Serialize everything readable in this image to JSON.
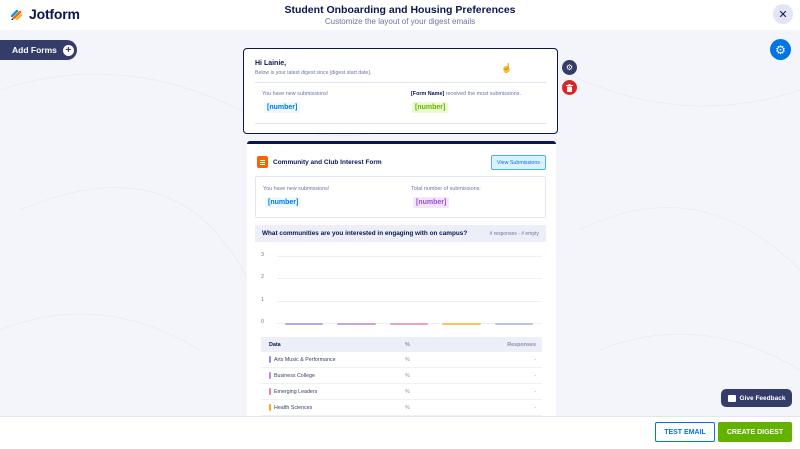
{
  "header": {
    "logo_text": "Jotform",
    "title": "Student Onboarding and Housing Preferences",
    "subtitle": "Customize the layout of your digest emails",
    "close_icon": "close-icon"
  },
  "sidebar": {
    "add_forms_label": "Add Forms"
  },
  "greeting": {
    "hi": "Hi Lainie,",
    "intro": "Below is your latest digest since [digest start date].",
    "new_submissions_label": "You have new submissions!",
    "new_submissions_value": "[number]",
    "top_form_name": "[Form Name]",
    "top_form_rest": " received the most submissions.",
    "top_form_value": "[number]"
  },
  "form_card": {
    "title": "Community and Club Interest Form",
    "view_button": "View Submissions",
    "new_submissions_label": "You have new submissions!",
    "new_submissions_value": "[number]",
    "total_label": "Total number of submissions:",
    "total_value": "[number]",
    "question": "What communities are you interested in engaging with on campus?",
    "question_meta": "# responses - # empty"
  },
  "chart_data": {
    "type": "bar",
    "categories": [
      "Arts Music & Performance",
      "Business College",
      "Emerging Leaders",
      "Health Sciences",
      ""
    ],
    "values": [
      0,
      0,
      0,
      0,
      0
    ],
    "yticks": [
      "3",
      "2",
      "1",
      "0"
    ],
    "ylim": [
      0,
      3
    ],
    "colors": [
      "#b7a6e0",
      "#c9a3e0",
      "#f0a3b5",
      "#ffc05c",
      "#b8c4f0"
    ]
  },
  "table": {
    "headers": {
      "data": "Data",
      "pct": "%",
      "responses": "Responses"
    },
    "rows": [
      {
        "label": "Arts Music & Performance",
        "pct": "%",
        "responses": "-",
        "color": "#9b8ad6"
      },
      {
        "label": "Business College",
        "pct": "%",
        "responses": "-",
        "color": "#c08ad8"
      },
      {
        "label": "Emerging Leaders",
        "pct": "%",
        "responses": "-",
        "color": "#ee7f9a"
      },
      {
        "label": "Health Sciences",
        "pct": "%",
        "responses": "-",
        "color": "#ffa515"
      }
    ]
  },
  "feedback": {
    "label": "Give Feedback"
  },
  "footer": {
    "test_email": "TEST EMAIL",
    "create_digest": "CREATE DIGEST"
  }
}
